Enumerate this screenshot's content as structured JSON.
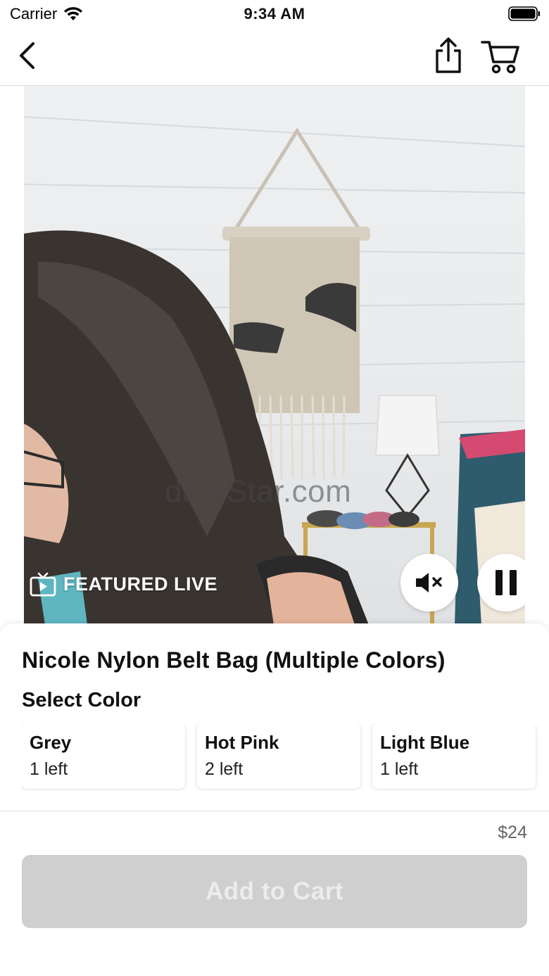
{
  "status_bar": {
    "carrier": "Carrier",
    "time": "9:34 AM"
  },
  "nav": {
    "back_icon": "chevron-left-icon",
    "share_icon": "share-icon",
    "cart_icon": "cart-icon"
  },
  "video": {
    "badge_label": "FEATURED LIVE",
    "badge_icon": "tv-play-icon",
    "watermark": "dateStar.com",
    "mute_icon": "speaker-muted-icon",
    "pause_icon": "pause-icon"
  },
  "product": {
    "title": "Nicole Nylon Belt Bag (Multiple Colors)",
    "select_label": "Select Color",
    "colors": [
      {
        "name": "Grey",
        "stock": "1 left"
      },
      {
        "name": "Hot Pink",
        "stock": "2 left"
      },
      {
        "name": "Light Blue",
        "stock": "1 left"
      }
    ]
  },
  "footer": {
    "price": "$24",
    "add_to_cart_label": "Add to Cart"
  },
  "colors": {
    "button_disabled": "#cfcfcf",
    "text_primary": "#111111",
    "price_text": "#666666"
  }
}
